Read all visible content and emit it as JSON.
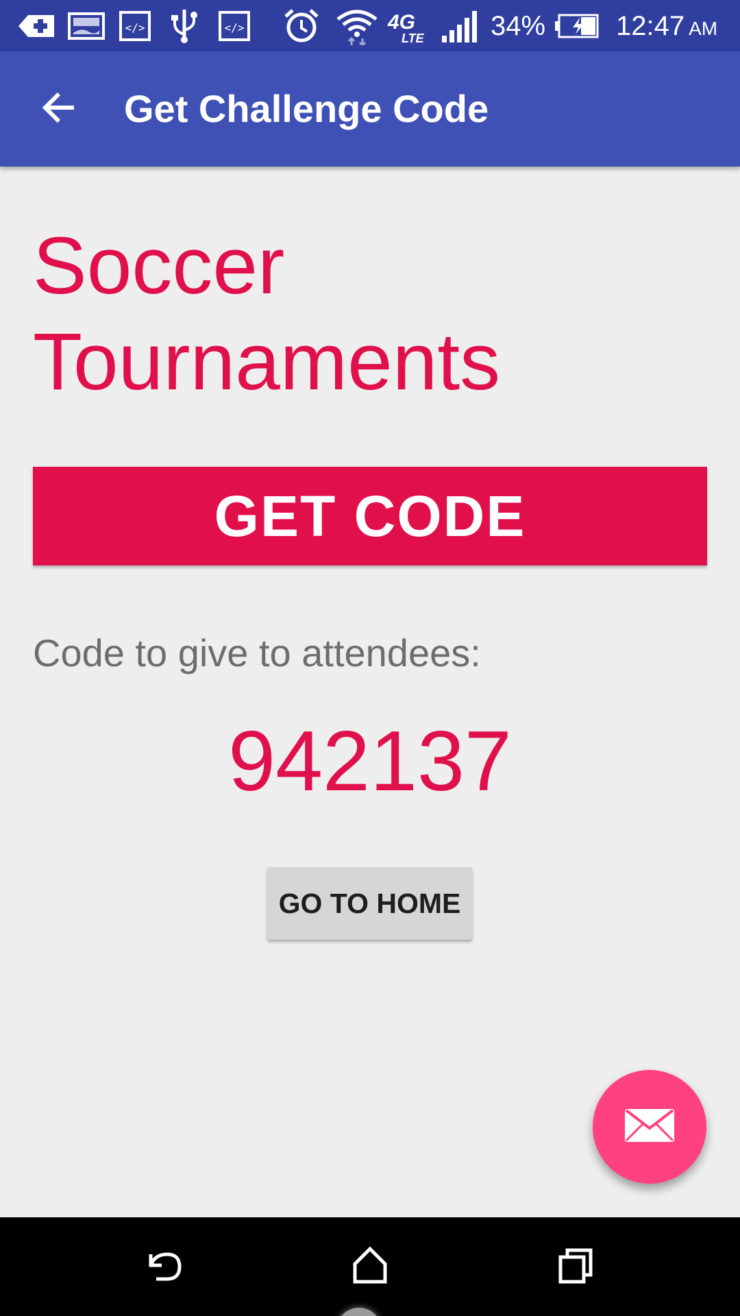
{
  "status_bar": {
    "battery_percent": "34%",
    "time": "12:47",
    "ampm": "AM",
    "network_label": "4G LTE",
    "icons": [
      "add-notification-icon",
      "image-icon",
      "developer-code-icon",
      "usb-icon",
      "developer-code-icon",
      "alarm-icon",
      "wifi-icon",
      "4g-lte-icon",
      "signal-icon",
      "battery-charging-icon"
    ]
  },
  "app_bar": {
    "title": "Get Challenge Code",
    "back_icon": "arrow-back-icon",
    "color": "#3f51b5"
  },
  "content": {
    "event_title": "Soccer Tournaments",
    "get_code_label": "GET CODE",
    "code_label": "Code to give to attendees:",
    "code_value": "942137",
    "home_button_label": "GO TO HOME"
  },
  "fab": {
    "icon": "mail-icon",
    "color": "#ff4081"
  },
  "nav_bar": {
    "icons": [
      "back-icon",
      "home-icon",
      "recents-icon"
    ]
  },
  "colors": {
    "accent": "#e0104c",
    "status_bar": "#303f9f",
    "background": "#eeeeee"
  }
}
